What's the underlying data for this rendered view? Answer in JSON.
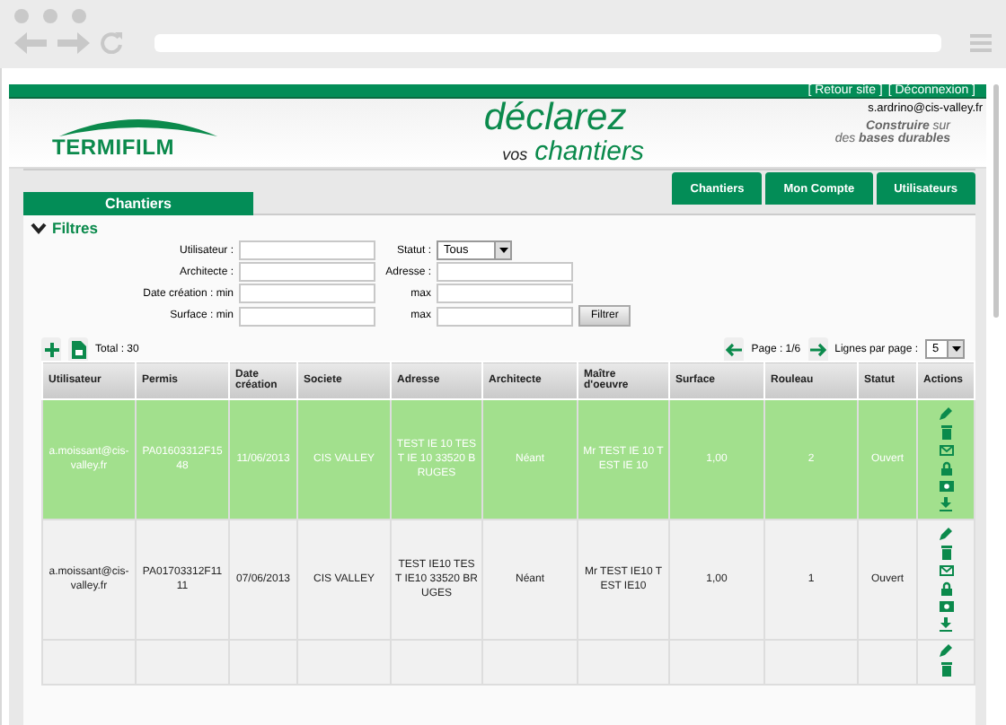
{
  "top_links": [
    "[ Retour site ]",
    "[ Déconnexion ]"
  ],
  "user_email": "s.ardrino@cis-valley.fr",
  "banner": {
    "logo": "TERMIFILM",
    "headline_1": "déclarez",
    "headline_2a": "vos",
    "headline_2b": "chantiers",
    "slogan_1": "**Construire** sur",
    "slogan_2": "des **bases durables**"
  },
  "section_title": "Chantiers",
  "nav_tabs": [
    {
      "label": "Chantiers",
      "selected": false
    },
    {
      "label": "Mon Compte",
      "selected": false
    },
    {
      "label": "Utilisateurs",
      "selected": false
    }
  ],
  "filters": {
    "title": "Filtres",
    "expanded": true,
    "utilisateur": "Utilisateur :",
    "statut": "Statut :",
    "statut_value": "Tous",
    "architecte": "Architecte :",
    "adresse": "Adresse :",
    "date_min": "Date création : min",
    "date_max": "max",
    "surface_min": "Surface : min",
    "surface_max": "max",
    "button": "Filtrer"
  },
  "toolbar": {
    "total": "Total : 30",
    "page": "Page : 1/6",
    "rows_label": "Lignes par page :",
    "rows_value": "5"
  },
  "table": {
    "columns": [
      "Utilisateur",
      "Permis",
      "Date création",
      "Societe",
      "Adresse",
      "Architecte",
      "Maître d'oeuvre",
      "Surface",
      "Rouleau",
      "Statut",
      "Actions"
    ],
    "rows": [
      {
        "selected": true,
        "cells": [
          "a.moissant@cis-valley.fr",
          "PA01603312F1548",
          "11/06/2013",
          "CIS VALLEY",
          "TEST IE 10 TEST IE 10 33520 BRUGES",
          "Néant",
          "Mr TEST IE 10 TEST IE 10",
          "1,00",
          "2",
          "Ouvert"
        ]
      },
      {
        "selected": false,
        "cells": [
          "a.moissant@cis-valley.fr",
          "PA01703312F1111",
          "07/06/2013",
          "CIS VALLEY",
          "TEST IE10 TEST IE10 33520 BRUGES",
          "Néant",
          "Mr TEST IE10 TEST IE10",
          "1,00",
          "1",
          "Ouvert"
        ]
      }
    ]
  }
}
